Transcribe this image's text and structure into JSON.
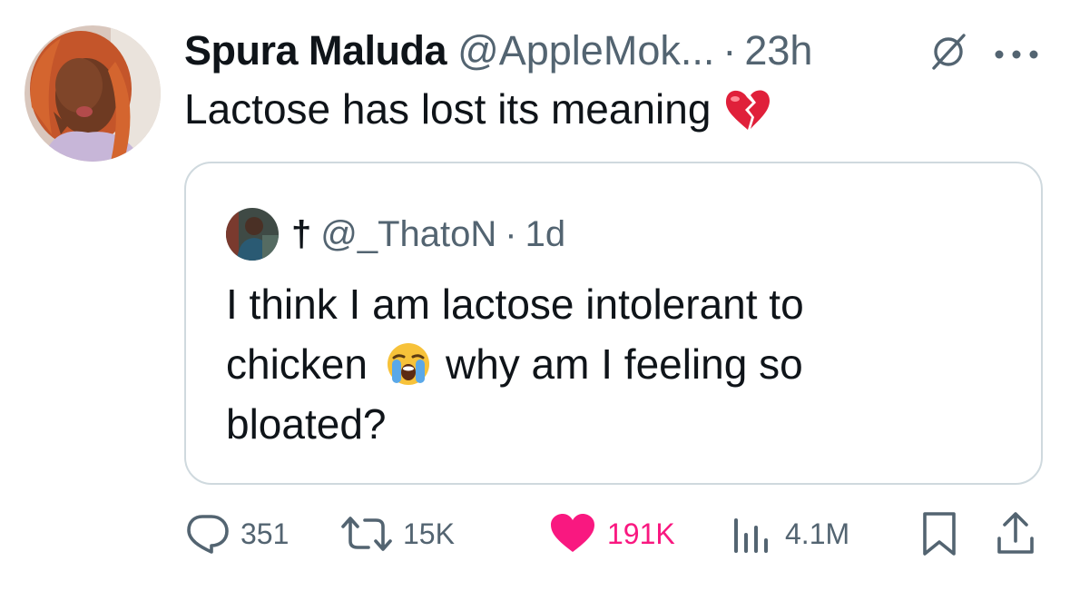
{
  "tweet": {
    "author_name": "Spura Maluda",
    "author_handle": "@AppleMok...",
    "separator": "·",
    "time": "23h",
    "text": "Lactose has lost its meaning",
    "text_emoji": "broken-heart-emoji",
    "avatar_icon": "user-avatar-woman",
    "badge_icon": "null-slash-circle-icon",
    "more_icon": "more-dots-icon"
  },
  "quoted": {
    "name": "†",
    "handle": "@_ThatoN",
    "separator": "·",
    "time": "1d",
    "line1": "I think I am lactose intolerant to",
    "line2_a": "chicken",
    "line2_b": "why am I feeling so",
    "line3": "bloated?",
    "emoji": "loudly-crying-face-emoji",
    "avatar_icon": "user-avatar-man"
  },
  "actions": {
    "replies": "351",
    "reposts": "15K",
    "likes": "191K",
    "views": "4.1M",
    "reply_icon": "reply-icon",
    "repost_icon": "repost-icon",
    "like_icon": "heart-icon",
    "views_icon": "views-icon",
    "bookmark_icon": "bookmark-icon",
    "share_icon": "share-icon"
  },
  "colors": {
    "text": "#0f1419",
    "muted": "#536471",
    "like": "#f91880",
    "border": "#cfd9de"
  }
}
